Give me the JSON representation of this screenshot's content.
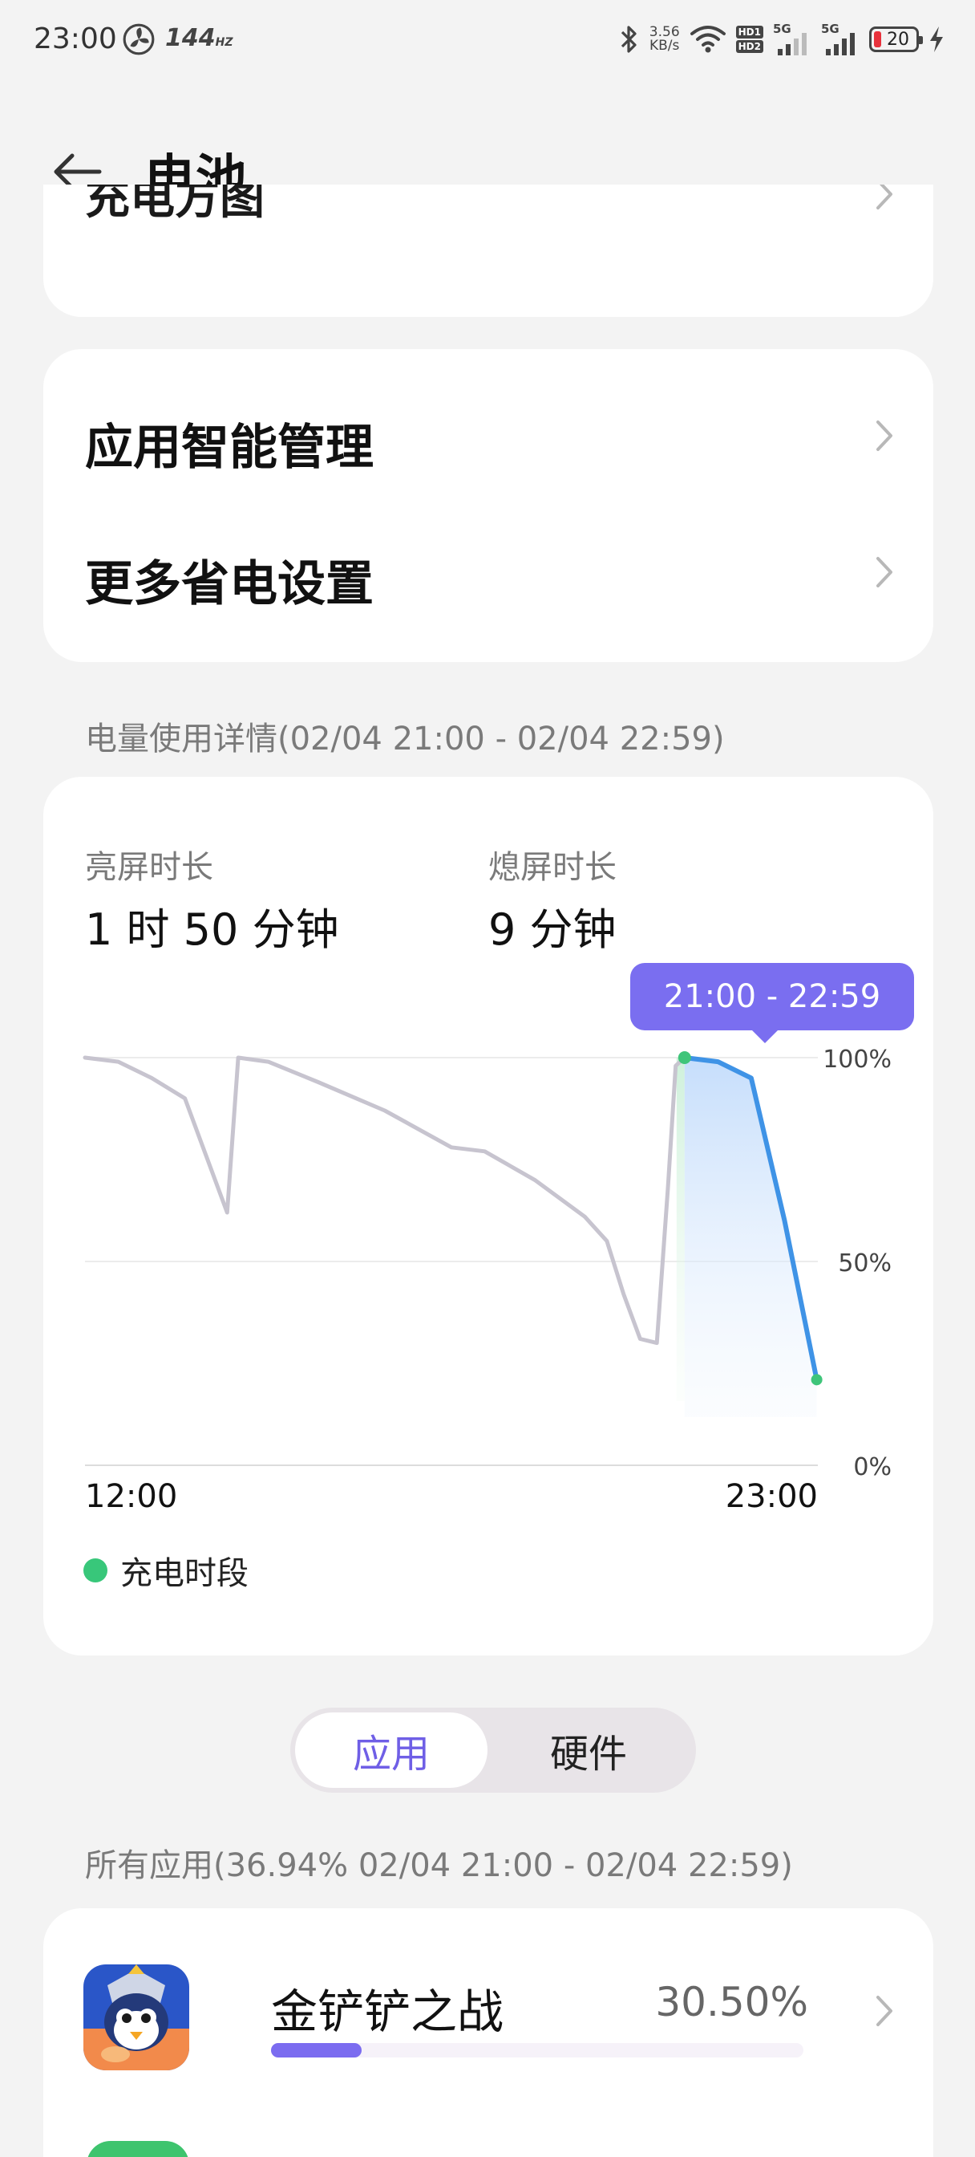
{
  "status_bar": {
    "time": "23:00",
    "refresh_rate": "144",
    "refresh_unit": "HZ",
    "net_speed_value": "3.56",
    "net_speed_unit": "KB/s",
    "hd1": "HD1",
    "hd2": "HD2",
    "sim1": "5G",
    "sim2": "5G",
    "battery_level": "20",
    "icons": [
      "fan-icon",
      "bluetooth-icon",
      "wifi-icon",
      "signal-icon",
      "battery-icon",
      "charging-bolt-icon"
    ]
  },
  "header": {
    "title": "电池"
  },
  "partial_card": {
    "label": "充电方图"
  },
  "settings": [
    {
      "label": "应用智能管理"
    },
    {
      "label": "更多省电设置"
    }
  ],
  "usage": {
    "caption": "电量使用详情(02/04 21:00 - 02/04 22:59)",
    "screen_on_label": "亮屏时长",
    "screen_on_value": "1 时 50 分钟",
    "screen_off_label": "熄屏时长",
    "screen_off_value": "9 分钟",
    "tooltip": "21:00 - 22:59",
    "legend_label": "充电时段"
  },
  "chart_data": {
    "type": "line",
    "x_start": "12:00",
    "x_end": "23:00",
    "x_ticks": [
      "12:00",
      "23:00"
    ],
    "y_ticks": [
      "100%",
      "50%",
      "0%"
    ],
    "ylim": [
      0,
      100
    ],
    "grid": true,
    "selected_range": "21:00 - 22:59",
    "series": [
      {
        "values": [
          [
            "12:00",
            100
          ],
          [
            "12:30",
            99
          ],
          [
            "13:00",
            95
          ],
          [
            "13:30",
            90
          ],
          [
            "14:08",
            62
          ],
          [
            "14:18",
            100
          ],
          [
            "14:45",
            99
          ],
          [
            "15:30",
            94
          ],
          [
            "16:30",
            87
          ],
          [
            "17:30",
            78
          ],
          [
            "18:00",
            77
          ],
          [
            "18:45",
            70
          ],
          [
            "19:30",
            61
          ],
          [
            "19:50",
            55
          ],
          [
            "20:05",
            42
          ],
          [
            "20:20",
            31
          ],
          [
            "20:35",
            30
          ],
          [
            "20:45",
            68
          ],
          [
            "20:52",
            98
          ],
          [
            "21:00",
            100
          ]
        ]
      },
      {
        "values": [
          [
            "21:00",
            100
          ],
          [
            "21:30",
            99
          ],
          [
            "22:00",
            95
          ],
          [
            "22:30",
            60
          ],
          [
            "22:59",
            21
          ]
        ]
      }
    ],
    "charging_period": {
      "start": "20:50",
      "end": "21:00"
    },
    "colors": {
      "past": "#c7c4cf",
      "selected": "#3f93e6",
      "charging": "#3fc57a",
      "accent": "#7a6ef0"
    }
  },
  "segmented": {
    "active": "应用",
    "inactive": "硬件"
  },
  "apps": {
    "caption": "所有应用(36.94% 02/04 21:00 - 02/04 22:59)",
    "items": [
      {
        "name": "金铲铲之战",
        "percent": "30.50%",
        "share": 0.305
      }
    ]
  }
}
